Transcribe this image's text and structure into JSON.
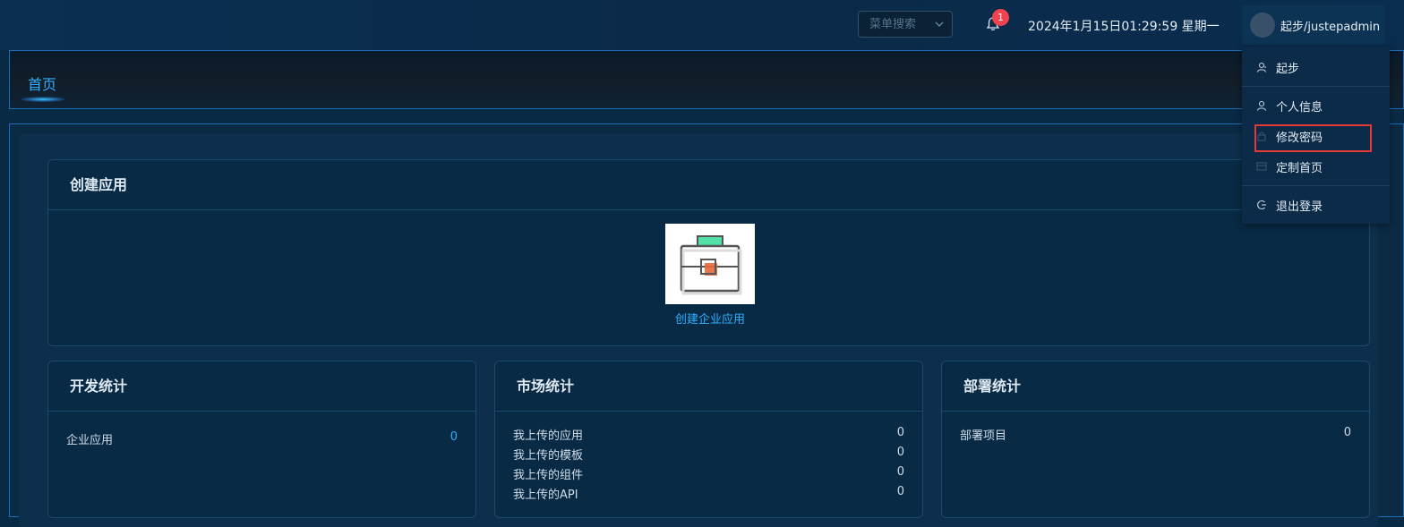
{
  "header": {
    "menu_search_placeholder": "菜单搜索",
    "notification_count": "1",
    "datetime": "2024年1月15日01:29:59 星期一",
    "user_label": "起步/justepadmin"
  },
  "tabs": {
    "home": "首页"
  },
  "create_app": {
    "title": "创建应用",
    "app_link": "创建企业应用"
  },
  "dev_stats": {
    "title": "开发统计",
    "rows": [
      {
        "label": "企业应用",
        "value": "0"
      }
    ]
  },
  "market_stats": {
    "title": "市场统计",
    "rows": [
      {
        "label": "我上传的应用",
        "value": "0"
      },
      {
        "label": "我上传的模板",
        "value": "0"
      },
      {
        "label": "我上传的组件",
        "value": "0"
      },
      {
        "label": "我上传的API",
        "value": "0"
      }
    ]
  },
  "deploy_stats": {
    "title": "部署统计",
    "rows": [
      {
        "label": "部署项目",
        "value": "0"
      }
    ]
  },
  "user_menu": {
    "items": [
      {
        "label": "起步",
        "icon": "user-switch-icon"
      },
      {
        "label": "个人信息",
        "icon": "user-icon"
      },
      {
        "label": "修改密码",
        "icon": "lock-icon"
      },
      {
        "label": "定制首页",
        "icon": "layout-icon"
      },
      {
        "label": "退出登录",
        "icon": "logout-icon"
      }
    ]
  },
  "colors": {
    "accent": "#2fb0ff",
    "badge": "#f0424f",
    "highlight_box": "#e53935",
    "background": "#082a45"
  }
}
